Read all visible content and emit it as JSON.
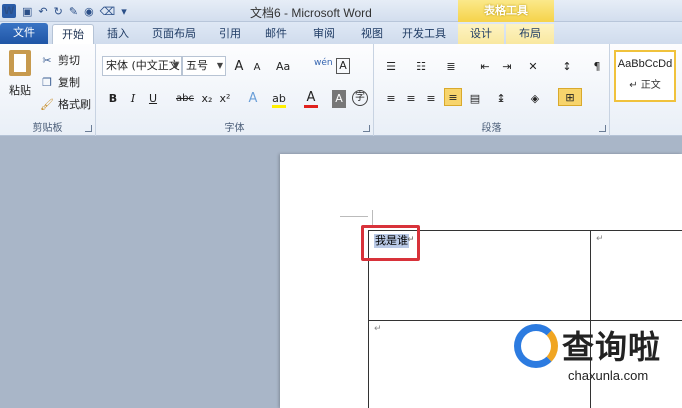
{
  "window": {
    "title": "文档6 - Microsoft Word",
    "app_icon_letter": "W"
  },
  "context_tab_group": "表格工具",
  "tabs": [
    {
      "label": "文件"
    },
    {
      "label": "开始"
    },
    {
      "label": "插入"
    },
    {
      "label": "页面布局"
    },
    {
      "label": "引用"
    },
    {
      "label": "邮件"
    },
    {
      "label": "审阅"
    },
    {
      "label": "视图"
    },
    {
      "label": "开发工具"
    },
    {
      "label": "设计"
    },
    {
      "label": "布局"
    }
  ],
  "clipboard": {
    "group_label": "剪贴板",
    "paste": "粘贴",
    "cut": "剪切",
    "copy": "复制",
    "format_painter": "格式刷"
  },
  "font": {
    "group_label": "字体",
    "font_name": "宋体 (中文正文",
    "font_size": "五号",
    "grow": "A",
    "shrink": "A",
    "case": "Aa",
    "clear": "A",
    "bold": "B",
    "italic": "I",
    "underline": "U",
    "strike": "abc",
    "subscript": "x₂",
    "superscript": "x²",
    "effects": "A",
    "font_color": "A",
    "char_shade": "A",
    "enclose": "字",
    "phonetic": "wén"
  },
  "paragraph": {
    "group_label": "段落"
  },
  "styles": {
    "sample": "AaBbCcDd",
    "name": "正文"
  },
  "document": {
    "selected_text": "我是谁",
    "para_mark": "↵",
    "cell_mark": "↵"
  },
  "watermark": {
    "name": "查询啦",
    "url": "chaxunla.com"
  }
}
